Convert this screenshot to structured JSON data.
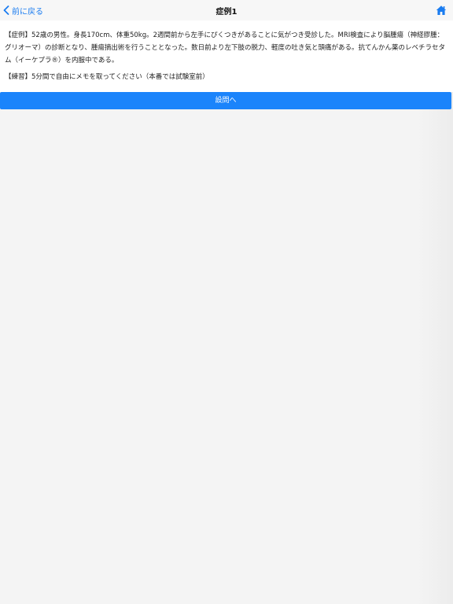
{
  "navbar": {
    "back_label": "前に戻る",
    "title": "症例1",
    "home_icon": "home-icon"
  },
  "content": {
    "case_description": "【症例】52歳の男性。身長170cm、体重50kg。2週間前から左手にぴくつきがあることに気がつき受診した。MRI検査により脳腫瘍（神経膠腫：グリオーマ）の診断となり、腫瘍摘出術を行うこととなった。数日前より左下肢の脱力、軽度の吐き気と頭痛がある。抗てんかん薬のレベチラセタム（イーケプラ®）を内服中である。",
    "practice_note": "【練習】5分間で自由にメモを取ってください（本番では試験室前）"
  },
  "actions": {
    "question_button_label": "設問へ"
  },
  "colors": {
    "accent": "#1b84fb",
    "link": "#1a7cf0",
    "navbar_bg": "#f7f7f7",
    "background": "#f4f4f4"
  }
}
